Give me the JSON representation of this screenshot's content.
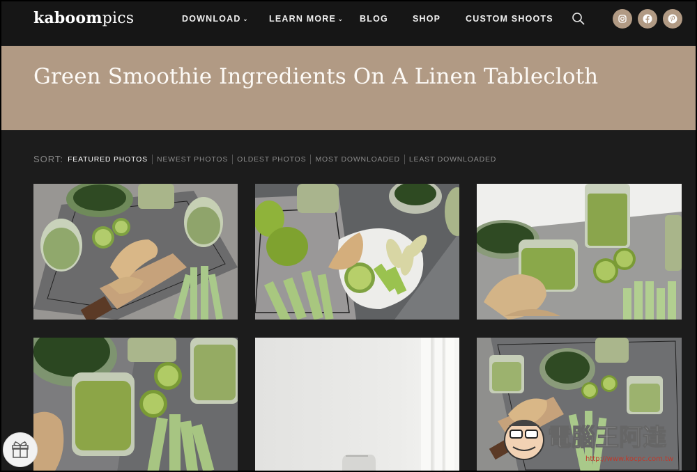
{
  "brand": {
    "bold": "kaboom",
    "light": "pics"
  },
  "nav": {
    "items": [
      {
        "label": "DOWNLOAD",
        "caret": "⌄"
      },
      {
        "label": "LEARN MORE",
        "caret": "⌄"
      },
      {
        "label": "BLOG",
        "caret": ""
      },
      {
        "label": "SHOP",
        "caret": ""
      },
      {
        "label": "CUSTOM SHOOTS",
        "caret": ""
      }
    ],
    "icons": [
      "search-icon",
      "instagram-icon",
      "facebook-icon",
      "pinterest-icon"
    ]
  },
  "page": {
    "title": "Green Smoothie Ingredients On A Linen Tablecloth"
  },
  "sort": {
    "label": "SORT:",
    "options": [
      "FEATURED PHOTOS",
      "NEWEST PHOTOS",
      "OLDEST PHOTOS",
      "MOST DOWNLOADED",
      "LEAST DOWNLOADED"
    ],
    "active": "FEATURED PHOTOS"
  },
  "photos": [
    {
      "subject": "green smoothie glasses with ginger, lime, celery and spinach on cutting board"
    },
    {
      "subject": "pears, apples, lime and ginger on white plate with celery"
    },
    {
      "subject": "green smoothie glass with lime, spinach bowl and ginger"
    },
    {
      "subject": "green smoothies with spinach, lime and celery close-up"
    },
    {
      "subject": "white wall with sheer curtain and glass pitcher"
    },
    {
      "subject": "overhead green smoothie spread with spinach and ginger"
    }
  ],
  "watermark": {
    "text": "電腦王阿達",
    "url": "http://www.kocpc.com.tw"
  },
  "colors": {
    "nav_bg": "#161616",
    "band": "#b19a84",
    "body_bg": "#1c1c1c",
    "social": "#b19a84"
  }
}
